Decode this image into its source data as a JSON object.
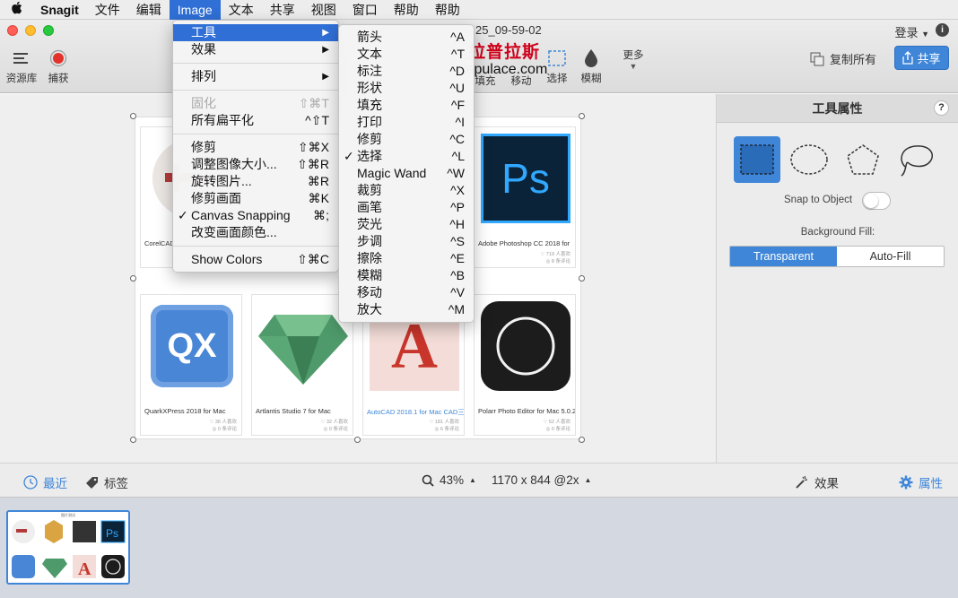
{
  "menubar": {
    "apple_icon": "",
    "app_name": "Snagit",
    "items": [
      "文件",
      "编辑",
      "Image",
      "文本",
      "共享",
      "视图",
      "窗口",
      "帮助",
      "帮助"
    ],
    "active_index": 2
  },
  "window": {
    "doc_title": "25_09-59-02",
    "login_label": "登录",
    "watermark": "拉普拉斯",
    "watermark_url": "lapulace.com",
    "copy_all_label": "复制所有",
    "share_label": "共享"
  },
  "toolbar": {
    "library_label": "资源库",
    "capture_label": "捕获",
    "fill_label": "填充",
    "move_label": "移动",
    "select_label": "选择",
    "blur_label": "模糊",
    "more_label": "更多"
  },
  "image_menu": {
    "items": [
      {
        "label": "工具",
        "shortcut": "",
        "submenu": true,
        "highlighted": true,
        "disabled": false,
        "checked": false
      },
      {
        "label": "效果",
        "shortcut": "",
        "submenu": true,
        "highlighted": false,
        "disabled": false,
        "checked": false
      },
      {
        "sep": true
      },
      {
        "label": "排列",
        "shortcut": "",
        "submenu": true,
        "highlighted": false,
        "disabled": false,
        "checked": false
      },
      {
        "sep": true
      },
      {
        "label": "固化",
        "shortcut": "⇧⌘T",
        "submenu": false,
        "highlighted": false,
        "disabled": true,
        "checked": false
      },
      {
        "label": "所有扁平化",
        "shortcut": "^⇧T",
        "submenu": false,
        "highlighted": false,
        "disabled": false,
        "checked": false
      },
      {
        "sep": true
      },
      {
        "label": "修剪",
        "shortcut": "⇧⌘X",
        "submenu": false,
        "highlighted": false,
        "disabled": false,
        "checked": false
      },
      {
        "label": "调整图像大小...",
        "shortcut": "⇧⌘R",
        "submenu": false,
        "highlighted": false,
        "disabled": false,
        "checked": false
      },
      {
        "label": "旋转图片...",
        "shortcut": "⌘R",
        "submenu": false,
        "highlighted": false,
        "disabled": false,
        "checked": false
      },
      {
        "label": "修剪画面",
        "shortcut": "⌘K",
        "submenu": false,
        "highlighted": false,
        "disabled": false,
        "checked": false
      },
      {
        "label": "Canvas Snapping",
        "shortcut": "⌘;",
        "submenu": false,
        "highlighted": false,
        "disabled": false,
        "checked": true
      },
      {
        "label": "改变画面颜色...",
        "shortcut": "",
        "submenu": false,
        "highlighted": false,
        "disabled": false,
        "checked": false
      },
      {
        "sep": true
      },
      {
        "label": "Show Colors",
        "shortcut": "⇧⌘C",
        "submenu": false,
        "highlighted": false,
        "disabled": false,
        "checked": false
      }
    ]
  },
  "tools_submenu": {
    "items": [
      {
        "label": "箭头",
        "shortcut": "^A",
        "checked": false
      },
      {
        "label": "文本",
        "shortcut": "^T",
        "checked": false
      },
      {
        "label": "标注",
        "shortcut": "^D",
        "checked": false
      },
      {
        "label": "形状",
        "shortcut": "^U",
        "checked": false
      },
      {
        "label": "填充",
        "shortcut": "^F",
        "checked": false
      },
      {
        "label": "打印",
        "shortcut": "^I",
        "checked": false
      },
      {
        "label": "修剪",
        "shortcut": "^C",
        "checked": false
      },
      {
        "label": "选择",
        "shortcut": "^L",
        "checked": true
      },
      {
        "label": "Magic Wand",
        "shortcut": "^W",
        "checked": false
      },
      {
        "label": "裁剪",
        "shortcut": "^X",
        "checked": false
      },
      {
        "label": "画笔",
        "shortcut": "^P",
        "checked": false
      },
      {
        "label": "荧光",
        "shortcut": "^H",
        "checked": false
      },
      {
        "label": "步调",
        "shortcut": "^S",
        "checked": false
      },
      {
        "label": "擦除",
        "shortcut": "^E",
        "checked": false
      },
      {
        "label": "模糊",
        "shortcut": "^B",
        "checked": false
      },
      {
        "label": "移动",
        "shortcut": "^V",
        "checked": false
      },
      {
        "label": "放大",
        "shortcut": "^M",
        "checked": false
      }
    ]
  },
  "canvas": {
    "cards": [
      {
        "title": "CorelCAD",
        "meta1": "",
        "meta2": "",
        "blue": false,
        "icon": "corelcad-icon"
      },
      {
        "title": "",
        "meta1": "",
        "meta2": "",
        "blue": false,
        "icon": "hidden"
      },
      {
        "title": "",
        "meta1": "",
        "meta2": "",
        "blue": false,
        "icon": "hidden"
      },
      {
        "title": "Adobe Photoshop CC 2018 for",
        "meta1": "♡ 719 人喜欢",
        "meta2": "◎ 8 条评论",
        "blue": false,
        "icon": "photoshop-icon"
      },
      {
        "title": "QuarkXPress 2018 for Mac",
        "meta1": "♡ 36 人喜欢",
        "meta2": "◎ 0 条评论",
        "blue": false,
        "icon": "quarkxpress-icon"
      },
      {
        "title": "Artlantis Studio 7 for Mac",
        "meta1": "♡ 32 人喜欢",
        "meta2": "◎ 0 条评论",
        "blue": false,
        "icon": "artlantis-icon"
      },
      {
        "title": "AutoCAD 2018.1 for Mac CAD三",
        "meta1": "♡ 181 人喜欢",
        "meta2": "◎ 6 条评论",
        "blue": true,
        "icon": "autocad-icon"
      },
      {
        "title": "Polarr Photo Editor for Mac 5.0.2",
        "meta1": "♡ 52 人喜欢",
        "meta2": "◎ 0 条评论",
        "blue": false,
        "icon": "polarr-icon"
      }
    ],
    "ps_text": "Ps",
    "qx_text": "QX",
    "a_text": "A"
  },
  "panel": {
    "title": "工具属性",
    "help": "?",
    "snap_label": "Snap to Object",
    "snap_on": false,
    "bg_fill_label": "Background Fill:",
    "fill_options": [
      "Transparent",
      "Auto-Fill"
    ],
    "fill_selected": 0
  },
  "bottom": {
    "recent_label": "最近",
    "tags_label": "标签",
    "zoom": "43%",
    "dimensions": "1170 x 844 @2x",
    "effects_label": "效果",
    "properties_label": "属性"
  },
  "tray": {
    "thumb_title": "图片测试"
  },
  "colors": {
    "accent": "#3f86d8",
    "menu_highlight": "#2f6fd6",
    "capture_red": "#e3322b"
  }
}
